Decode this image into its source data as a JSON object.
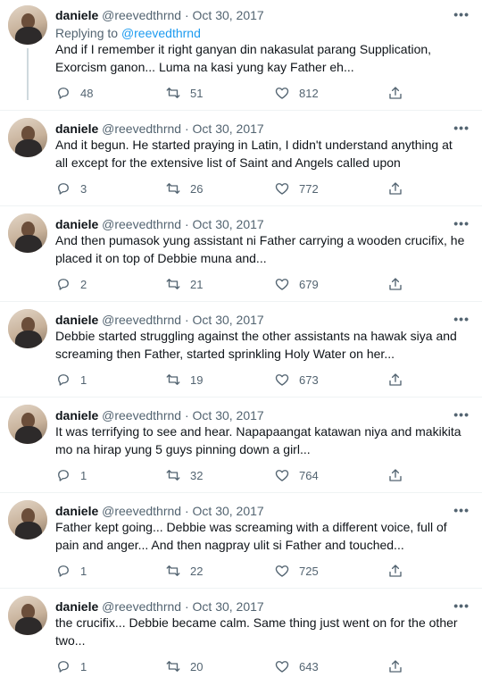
{
  "tweets": [
    {
      "name": "daniele",
      "handle": "@reevedthrnd",
      "sep": "·",
      "date": "Oct 30, 2017",
      "more": "•••",
      "replying_prefix": "Replying to",
      "replying_handle": "@reevedthrnd",
      "text": "And if I remember it right ganyan din nakasulat parang Supplication, Exorcism ganon... Luma na kasi yung kay Father eh...",
      "replies": "48",
      "retweets": "51",
      "likes": "812"
    },
    {
      "name": "daniele",
      "handle": "@reevedthrnd",
      "sep": "·",
      "date": "Oct 30, 2017",
      "more": "•••",
      "text": "And it begun. He started praying in Latin, I didn't understand anything at all except for the extensive list of Saint and Angels called upon",
      "replies": "3",
      "retweets": "26",
      "likes": "772"
    },
    {
      "name": "daniele",
      "handle": "@reevedthrnd",
      "sep": "·",
      "date": "Oct 30, 2017",
      "more": "•••",
      "text": "And then pumasok yung assistant ni Father carrying a wooden crucifix, he placed it on top of Debbie muna and...",
      "replies": "2",
      "retweets": "21",
      "likes": "679"
    },
    {
      "name": "daniele",
      "handle": "@reevedthrnd",
      "sep": "·",
      "date": "Oct 30, 2017",
      "more": "•••",
      "text": "Debbie started struggling against the other assistants na hawak siya and screaming then Father, started sprinkling Holy Water on her...",
      "replies": "1",
      "retweets": "19",
      "likes": "673"
    },
    {
      "name": "daniele",
      "handle": "@reevedthrnd",
      "sep": "·",
      "date": "Oct 30, 2017",
      "more": "•••",
      "text": "It was terrifying to see and hear. Napapaangat katawan niya and makikita mo na hirap yung 5 guys pinning down a girl...",
      "replies": "1",
      "retweets": "32",
      "likes": "764"
    },
    {
      "name": "daniele",
      "handle": "@reevedthrnd",
      "sep": "·",
      "date": "Oct 30, 2017",
      "more": "•••",
      "text": "Father kept going... Debbie was screaming with a different voice, full of pain and anger... And then nagpray ulit si Father and touched...",
      "replies": "1",
      "retweets": "22",
      "likes": "725"
    },
    {
      "name": "daniele",
      "handle": "@reevedthrnd",
      "sep": "·",
      "date": "Oct 30, 2017",
      "more": "•••",
      "text": "the crucifix... Debbie became calm. Same thing just went on for the other two...",
      "replies": "1",
      "retweets": "20",
      "likes": "643"
    }
  ],
  "icons": {
    "reply": "reply-icon",
    "retweet": "retweet-icon",
    "like": "heart-icon",
    "share": "share-icon"
  }
}
